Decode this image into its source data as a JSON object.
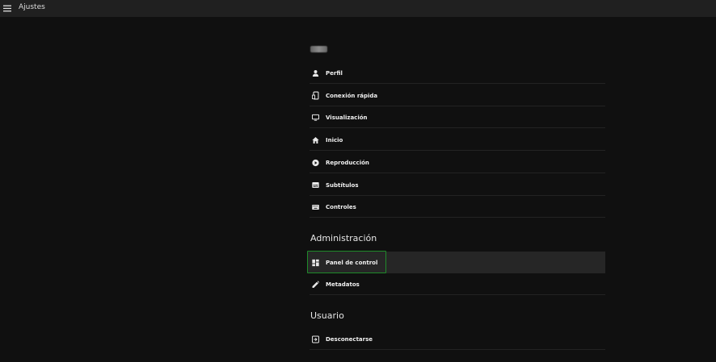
{
  "app": {
    "title": "Ajustes"
  },
  "header": {
    "menu_icon": "hamburger-menu-icon"
  },
  "user": {
    "name_blurred": true
  },
  "settings_items": [
    {
      "label": "Perfil",
      "icon": "person-icon"
    },
    {
      "label": "Conexión rápida",
      "icon": "quick-connect-icon"
    },
    {
      "label": "Visualización",
      "icon": "monitor-icon"
    },
    {
      "label": "Inicio",
      "icon": "home-icon"
    },
    {
      "label": "Reproducción",
      "icon": "play-circle-icon"
    },
    {
      "label": "Subtítulos",
      "icon": "subtitles-icon"
    },
    {
      "label": "Controles",
      "icon": "keyboard-icon"
    }
  ],
  "admin": {
    "title": "Administración",
    "items": [
      {
        "label": "Panel de control",
        "icon": "dashboard-icon",
        "selected": true
      },
      {
        "label": "Metadatos",
        "icon": "pencil-icon",
        "selected": false
      }
    ]
  },
  "user_section": {
    "title": "Usuario",
    "items": [
      {
        "label": "Desconectarse",
        "icon": "logout-icon"
      }
    ]
  },
  "colors": {
    "background": "#101010",
    "topbar": "#202020",
    "selected_row": "#262626",
    "focus_outline": "#1f8a2a"
  }
}
